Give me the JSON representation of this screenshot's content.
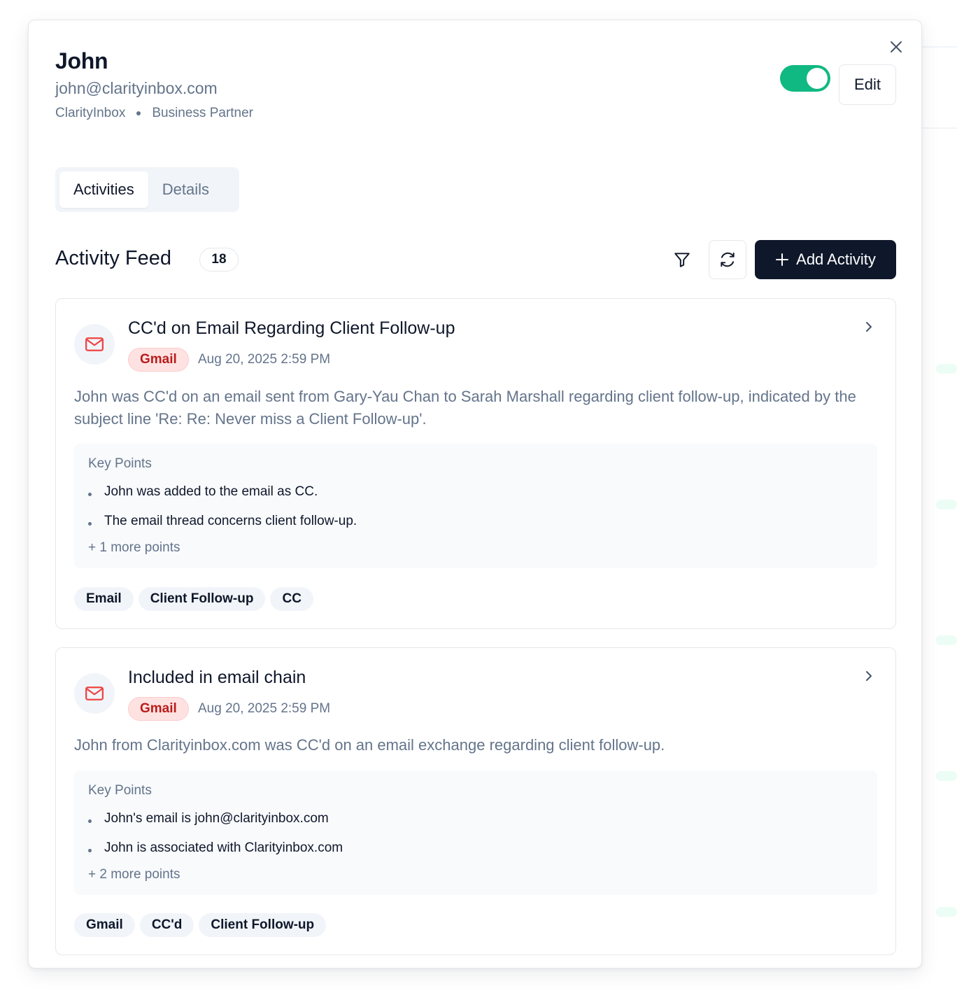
{
  "contact": {
    "name": "John",
    "email": "john@clarityinbox.com",
    "company": "ClarityInbox",
    "role": "Business Partner",
    "toggle_on": true,
    "edit_label": "Edit"
  },
  "tabs": [
    {
      "label": "Activities",
      "active": true
    },
    {
      "label": "Details",
      "active": false
    }
  ],
  "feed": {
    "title": "Activity Feed",
    "count": "18",
    "add_label": "Add Activity"
  },
  "activities": [
    {
      "title": "CC'd on Email Regarding Client Follow-up",
      "source": "Gmail",
      "time": "Aug 20, 2025 2:59 PM",
      "summary": "John was CC'd on an email sent from Gary-Yau Chan to Sarah Marshall regarding client follow-up, indicated by the subject line 'Re: Re: Never miss a Client Follow-up'.",
      "key_points_title": "Key Points",
      "key_points": [
        "John was added to the email as CC.",
        "The email thread concerns client follow-up."
      ],
      "more_points": "+ 1 more points",
      "tags": [
        "Email",
        "Client Follow-up",
        "CC"
      ]
    },
    {
      "title": "Included in email chain",
      "source": "Gmail",
      "time": "Aug 20, 2025 2:59 PM",
      "summary": "John from Clarityinbox.com was CC'd on an email exchange regarding client follow-up.",
      "key_points_title": "Key Points",
      "key_points": [
        "John's email is john@clarityinbox.com",
        "John is associated with Clarityinbox.com"
      ],
      "more_points": "+ 2 more points",
      "tags": [
        "Gmail",
        "CC'd",
        "Client Follow-up"
      ]
    }
  ],
  "colors": {
    "accent_green": "#10b981",
    "primary_dark": "#0f172a",
    "gmail_red": "#b91c1c",
    "mail_icon_red": "#ef4444"
  },
  "icons": [
    "close-icon",
    "filter-icon",
    "refresh-icon",
    "plus-icon",
    "mail-icon",
    "chevron-right-icon"
  ]
}
